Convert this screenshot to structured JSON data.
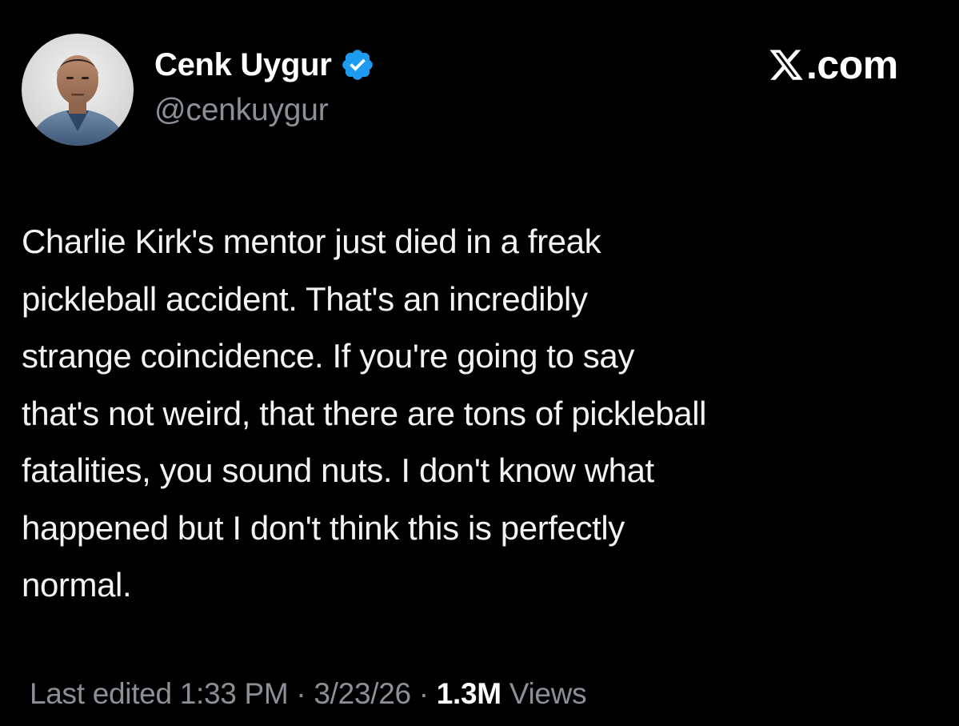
{
  "author": {
    "display_name": "Cenk Uygur",
    "handle": "@cenkuygur",
    "verified": true,
    "verified_badge_color": "#1d9bf0"
  },
  "branding": {
    "logo_icon": "x-logo-icon",
    "site_text": ".com"
  },
  "tweet": {
    "text": "Charlie Kirk's mentor just died in a freak\npickleball accident.  That's an incredibly\nstrange coincidence. If you're going to say\nthat's not weird, that there are tons of pickleball\nfatalities, you sound nuts. I don't know what\nhappened but I don't think this is perfectly\nnormal."
  },
  "meta": {
    "edited_label": "Last edited ",
    "time": "1:33 PM",
    "separator_1": " · ",
    "date": "3/23/26",
    "separator_2": "  · ",
    "views_count": "1.3M",
    "views_label": " Views"
  },
  "colors": {
    "background": "#000000",
    "primary_text": "#e7e9ea",
    "secondary_text": "#8b9096",
    "accent": "#1d9bf0"
  }
}
